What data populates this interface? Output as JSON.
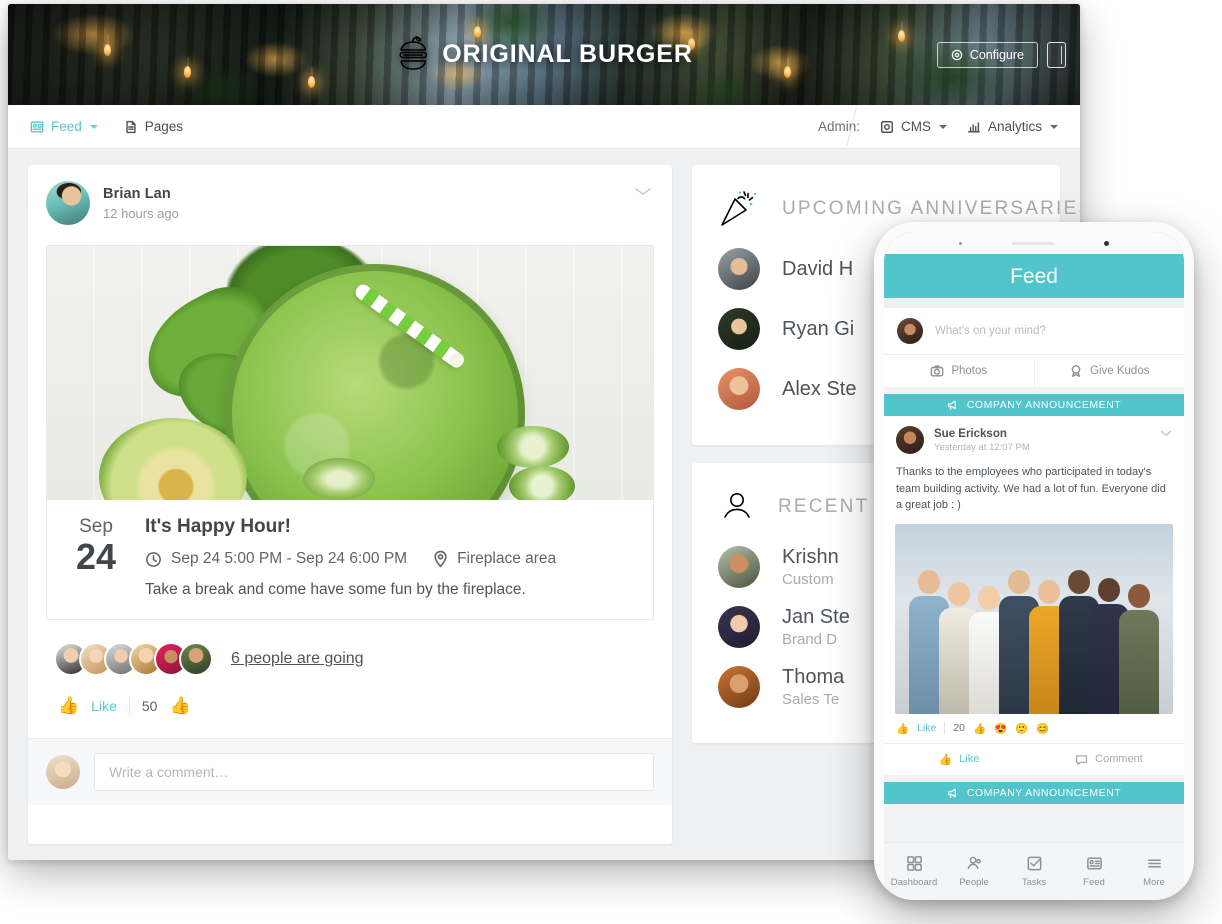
{
  "hero": {
    "brand_name": "ORIGINAL BURGER",
    "logo_icon": "burger-icon",
    "configure_label": "Configure",
    "configure_icon": "gear-icon",
    "mobile_preview_icon": "mobile-device-icon"
  },
  "nav": {
    "left_items": [
      {
        "label": "Feed",
        "icon": "feed-icon",
        "active": true,
        "has_caret": true
      },
      {
        "label": "Pages",
        "icon": "page-icon",
        "active": false,
        "has_caret": false
      }
    ],
    "admin_label": "Admin:",
    "right_items": [
      {
        "label": "CMS",
        "icon": "cms-icon",
        "has_caret": true
      },
      {
        "label": "Analytics",
        "icon": "analytics-icon",
        "has_caret": true
      }
    ]
  },
  "post": {
    "author": "Brian Lan",
    "timestamp": "12 hours ago",
    "menu_icon": "chevron-down-icon",
    "event": {
      "image_alt": "green smoothie with kale spinach avocado and cucumber",
      "month": "Sep",
      "day": "24",
      "title": "It's Happy Hour!",
      "time_icon": "clock-icon",
      "time_range": "Sep 24 5:00 PM - Sep 24 6:00 PM",
      "location_icon": "location-pin-icon",
      "location": "Fireplace area",
      "description": "Take a break and come have some fun by the fireplace."
    },
    "going_link": "6 people are going",
    "going_avatar_count": 6,
    "like_label": "Like",
    "like_icon": "thumbs-up-icon",
    "like_count": "50",
    "reaction_icon": "thumbs-up-icon"
  },
  "comment": {
    "placeholder": "Write a comment…",
    "avatar": "current-user-avatar"
  },
  "widgets": [
    {
      "title": "UPCOMING ANNIVERSARIES",
      "icon": "party-popper-icon",
      "rows": [
        {
          "name": "David H",
          "sub": ""
        },
        {
          "name": "Ryan Gi",
          "sub": ""
        },
        {
          "name": "Alex Ste",
          "sub": ""
        }
      ]
    },
    {
      "title": "RECENT",
      "icon": "person-icon",
      "rows": [
        {
          "name": "Krishn",
          "sub": "Custom"
        },
        {
          "name": "Jan Ste",
          "sub": "Brand D"
        },
        {
          "name": "Thoma",
          "sub": "Sales Te"
        }
      ]
    }
  ],
  "phone": {
    "header_title": "Feed",
    "composer": {
      "placeholder": "What's on your mind?",
      "buttons": [
        {
          "label": "Photos",
          "icon": "camera-icon"
        },
        {
          "label": "Give Kudos",
          "icon": "award-icon"
        }
      ]
    },
    "announcement_banner": "COMPANY ANNOUNCEMENT",
    "announcement_icon": "megaphone-icon",
    "post": {
      "author": "Sue Erickson",
      "timestamp": "Yesterday at 12:07 PM",
      "menu_icon": "chevron-down-icon",
      "text": "Thanks to the employees who participated in today's team building activity. We had a lot of fun. Everyone did a great job : )",
      "image_alt": "team group photo of eight smiling colleagues",
      "like_label": "Like",
      "like_icon": "thumbs-up-icon",
      "reaction_count": "20",
      "reactions": [
        "👍",
        "😍",
        "🙂",
        "😊"
      ],
      "comment_label": "Comment",
      "comment_icon": "comment-icon"
    },
    "announcement_banner_2": "COMPANY ANNOUNCEMENT",
    "tabs": [
      {
        "label": "Dashboard",
        "icon": "grid-icon"
      },
      {
        "label": "People",
        "icon": "people-icon"
      },
      {
        "label": "Tasks",
        "icon": "checkbox-icon"
      },
      {
        "label": "Feed",
        "icon": "feed-icon"
      },
      {
        "label": "More",
        "icon": "hamburger-icon"
      }
    ]
  },
  "colors": {
    "accent_teal": "#51C4CC",
    "link_teal": "#5BC6CF",
    "text_dark": "#3F464C",
    "text_muted": "#A7ACB1",
    "page_bg": "#EEF0F2"
  }
}
